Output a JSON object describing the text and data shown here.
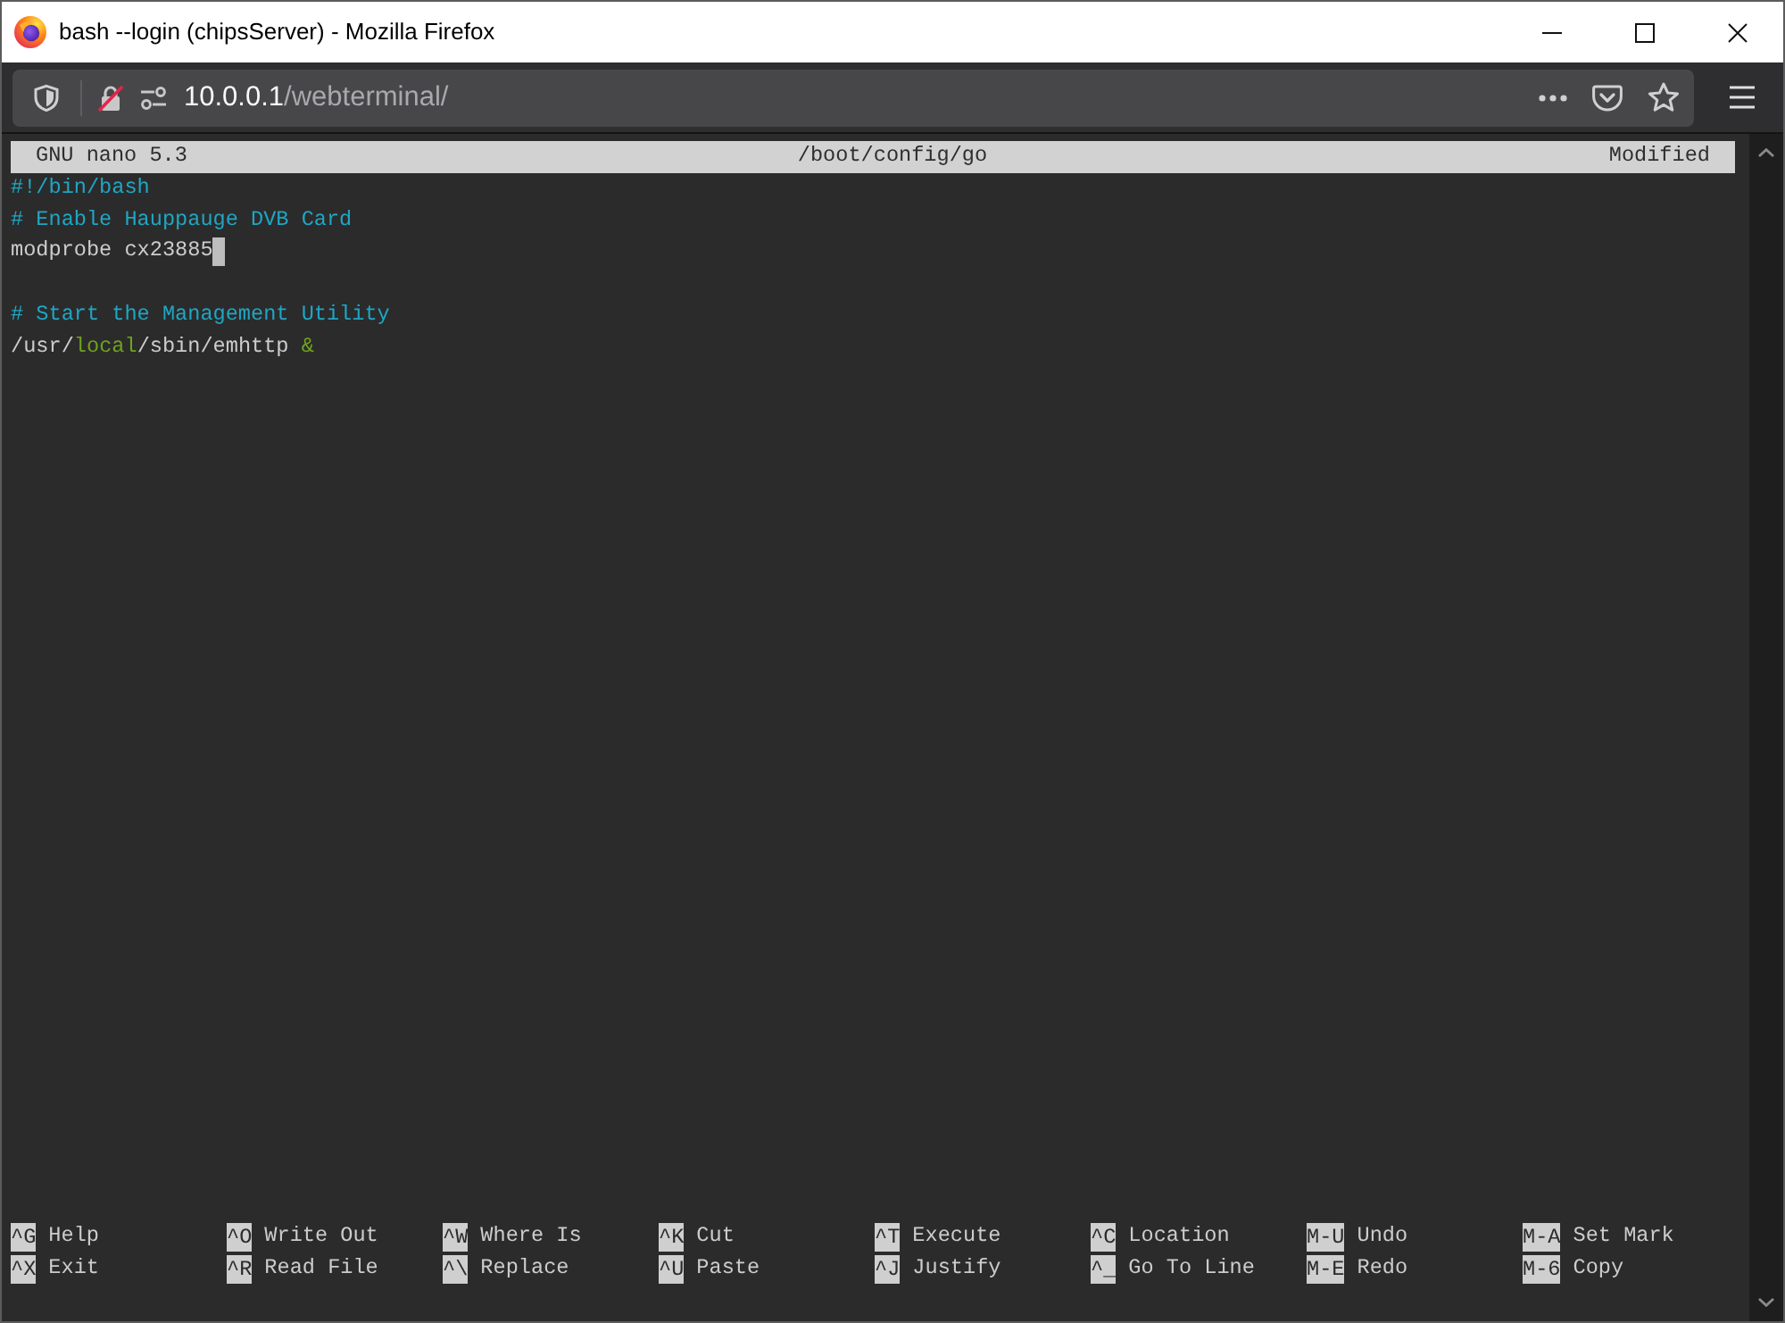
{
  "window": {
    "title": "bash --login (chipsServer) - Mozilla Firefox"
  },
  "address_bar": {
    "host": "10.0.0.1",
    "path": "/webterminal/"
  },
  "nano": {
    "header": {
      "version": "GNU nano 5.3",
      "file": "/boot/config/go",
      "status": "Modified"
    },
    "lines": [
      {
        "segments": [
          {
            "text": "#!/bin/bash",
            "kind": "comment"
          }
        ],
        "cursor": false
      },
      {
        "segments": [
          {
            "text": "# Enable Hauppauge DVB Card",
            "kind": "comment"
          }
        ],
        "cursor": false
      },
      {
        "segments": [
          {
            "text": "modprobe cx23885",
            "kind": "plain"
          }
        ],
        "cursor": true
      },
      {
        "cursor": false
      },
      {
        "segments": [
          {
            "text": "# Start the Management Utility",
            "kind": "comment"
          }
        ],
        "cursor": false
      },
      {
        "segments": [
          {
            "text": "/usr/",
            "kind": "plain"
          },
          {
            "text": "local",
            "kind": "accent"
          },
          {
            "text": "/sbin/emhttp ",
            "kind": "plain"
          },
          {
            "text": "&",
            "kind": "accent"
          }
        ],
        "cursor": false
      }
    ],
    "shortcut_rows": [
      [
        {
          "key": "^G",
          "label": "Help"
        },
        {
          "key": "^O",
          "label": "Write Out"
        },
        {
          "key": "^W",
          "label": "Where Is"
        },
        {
          "key": "^K",
          "label": "Cut"
        },
        {
          "key": "^T",
          "label": "Execute"
        },
        {
          "key": "^C",
          "label": "Location"
        },
        {
          "key": "M-U",
          "label": "Undo"
        },
        {
          "key": "M-A",
          "label": "Set Mark"
        }
      ],
      [
        {
          "key": "^X",
          "label": "Exit"
        },
        {
          "key": "^R",
          "label": "Read File"
        },
        {
          "key": "^\\",
          "label": "Replace"
        },
        {
          "key": "^U",
          "label": "Paste"
        },
        {
          "key": "^J",
          "label": "Justify"
        },
        {
          "key": "^_",
          "label": "Go To Line"
        },
        {
          "key": "M-E",
          "label": "Redo"
        },
        {
          "key": "M-6",
          "label": "Copy"
        }
      ]
    ]
  }
}
